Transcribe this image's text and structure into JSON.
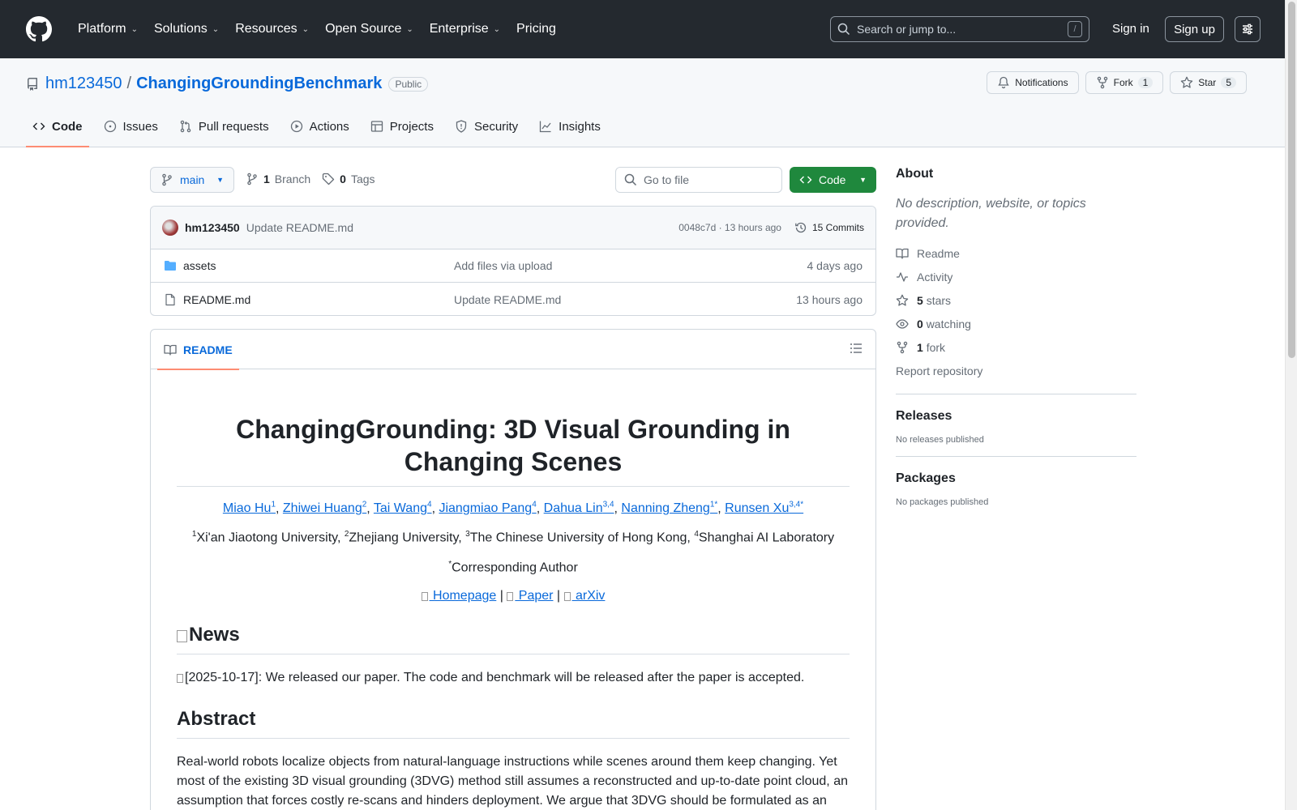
{
  "header": {
    "nav": [
      "Platform",
      "Solutions",
      "Resources",
      "Open Source",
      "Enterprise",
      "Pricing"
    ],
    "search_placeholder": "Search or jump to...",
    "slash": "/",
    "signin": "Sign in",
    "signup": "Sign up"
  },
  "repo": {
    "owner": "hm123450",
    "separator": "/",
    "name": "ChangingGroundingBenchmark",
    "visibility": "Public",
    "notifications": "Notifications",
    "fork_label": "Fork",
    "fork_count": "1",
    "star_label": "Star",
    "star_count": "5",
    "tabs": [
      "Code",
      "Issues",
      "Pull requests",
      "Actions",
      "Projects",
      "Security",
      "Insights"
    ]
  },
  "toolbar": {
    "branch": "main",
    "branch_count": "1",
    "branch_label": "Branch",
    "tag_count": "0",
    "tag_label": "Tags",
    "goto_placeholder": "Go to file",
    "code_label": "Code"
  },
  "commit": {
    "author": "hm123450",
    "message": "Update README.md",
    "hash_time": "0048c7d · 13 hours ago",
    "commits": "15 Commits"
  },
  "files": [
    {
      "name": "assets",
      "message": "Add files via upload",
      "time": "4 days ago",
      "type": "folder"
    },
    {
      "name": "README.md",
      "message": "Update README.md",
      "time": "13 hours ago",
      "type": "file"
    }
  ],
  "readme": {
    "tab": "README",
    "title": "ChangingGrounding: 3D Visual Grounding in Changing Scenes",
    "authors": [
      {
        "name": "Miao Hu",
        "sup": "1"
      },
      {
        "name": "Zhiwei Huang",
        "sup": "2"
      },
      {
        "name": "Tai Wang",
        "sup": "4"
      },
      {
        "name": "Jiangmiao Pang",
        "sup": "4"
      },
      {
        "name": "Dahua Lin",
        "sup": "3,4"
      },
      {
        "name": "Nanning Zheng",
        "sup": "1*"
      },
      {
        "name": "Runsen Xu",
        "sup": "3,4*"
      }
    ],
    "affiliations": [
      {
        "sup": "1",
        "text": "Xi'an Jiaotong University, "
      },
      {
        "sup": "2",
        "text": "Zhejiang University, "
      },
      {
        "sup": "3",
        "text": "The Chinese University of Hong Kong, "
      },
      {
        "sup": "4",
        "text": "Shanghai AI Laboratory"
      }
    ],
    "corresponding": {
      "sup": "*",
      "text": "Corresponding Author"
    },
    "links": [
      " Homepage",
      " Paper",
      " arXiv"
    ],
    "link_sep": " | ",
    "news_heading": "News",
    "news_item": "[2025-10-17]: We released our paper. The code and benchmark will be released after the paper is accepted.",
    "abstract_heading": "Abstract",
    "abstract_text": "Real-world robots localize objects from natural-language instructions while scenes around them keep changing. Yet most of the existing 3D visual grounding (3DVG) method still assumes a reconstructed and up-to-date point cloud, an assumption that forces costly re-scans and hinders deployment. We argue that 3DVG should be formulated as an"
  },
  "sidebar": {
    "about": "About",
    "description": "No description, website, or topics provided.",
    "readme": "Readme",
    "activity": "Activity",
    "stars_count": "5",
    "stars_label": "stars",
    "watching_count": "0",
    "watching_label": "watching",
    "fork_count": "1",
    "fork_label": "fork",
    "report": "Report repository",
    "releases": "Releases",
    "releases_none": "No releases published",
    "packages": "Packages",
    "packages_none": "No packages published"
  }
}
